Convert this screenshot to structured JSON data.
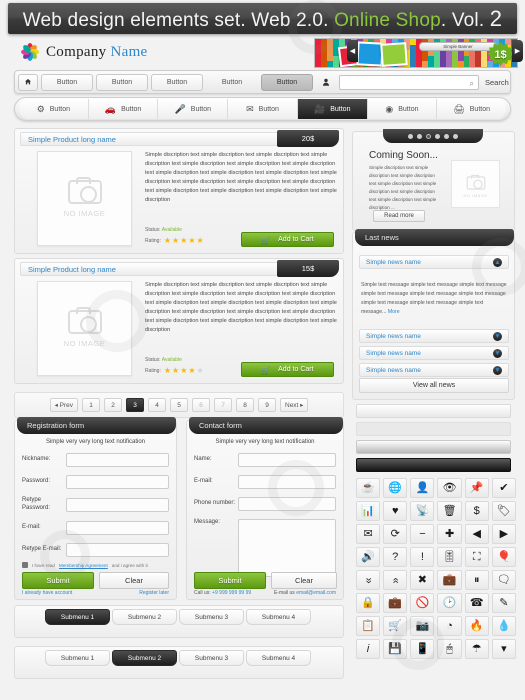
{
  "title": {
    "part1": "Web design elements set. Web 2.0. ",
    "highlight": "Online Shop",
    "part3": ". Vol. ",
    "volume": "2"
  },
  "logo": {
    "company": "Company ",
    "name": "Name"
  },
  "banner": {
    "label": "Simple Banner",
    "price_badge": "1$"
  },
  "topnav": {
    "home_icon": "home-icon",
    "buttons": [
      "Button",
      "Button",
      "Button",
      "Button",
      "Button"
    ],
    "user_icon": "user-icon",
    "search_placeholder": "",
    "search_label": "Search",
    "search_icon": "magnifier-icon"
  },
  "subnav": {
    "items": [
      {
        "label": "Button",
        "icon": "gear-icon"
      },
      {
        "label": "Button",
        "icon": "car-icon"
      },
      {
        "label": "Button",
        "icon": "microphone-icon"
      },
      {
        "label": "Button",
        "icon": "envelope-icon"
      },
      {
        "label": "Button",
        "icon": "video-camera-icon"
      },
      {
        "label": "Button",
        "icon": "disc-icon"
      },
      {
        "label": "Button",
        "icon": "printer-icon"
      }
    ],
    "active_index": 4
  },
  "products": [
    {
      "title": "Simple Product long name",
      "price": "20$",
      "image_placeholder": "NO IMAGE",
      "description": "Simple discription text simple discription text simple discription text simple discription text simple discription text simple discription text simple discription text simple discription text simple discription text simple discription text simple discription text simple discription text simple discription text simple discription text simple discription text simple discription text simple discription text simple discription",
      "status_label": "Status:",
      "status_value": "Available",
      "rating_label": "Rating:",
      "rating": 5,
      "cart_button": "Add to Cart"
    },
    {
      "title": "Simple Product long name",
      "price": "15$",
      "image_placeholder": "NO IMAGE",
      "description": "Simple discription text simple discription text simple discription text simple discription text simple discription text simple discription text simple discription text simple discription text simple discription text simple discription text simple discription text simple discription text simple discription text simple discription text simple discription text simple discription text simple discription text simple discription",
      "status_label": "Status:",
      "status_value": "Available",
      "rating_label": "Rating:",
      "rating": 4,
      "cart_button": "Add to Cart"
    }
  ],
  "coming_soon": {
    "title": "Coming Soon...",
    "text": "Simple discription text simple discription text simple discription text simple discription text simple discription text simple discription text simple discription text simple discription ...",
    "image_placeholder": "NO IMAGE",
    "read_more": "Read more",
    "prev_arrow": "◀",
    "next_arrow": "▶"
  },
  "news": {
    "header": "Last news",
    "items": [
      "Simple news name",
      "Simple news name",
      "Simple news name",
      "Simple news name"
    ],
    "body": "Simple text message simple text message  simple text message simple text message simple text message simple text message simple text message simple text message simple text message... ",
    "more": "More",
    "view_all": "View all news"
  },
  "pagination": {
    "prev": "◂ Prev",
    "pages": [
      "1",
      "2",
      "3",
      "4",
      "5",
      "6",
      "7",
      "8",
      "9"
    ],
    "active": "3",
    "next": "Next ▸"
  },
  "registration_form": {
    "header": "Registration form",
    "note": "Simple very very long text notification",
    "fields": [
      {
        "label": "Nickname:",
        "value": ""
      },
      {
        "label": "Password:",
        "value": ""
      },
      {
        "label": "Retype Password:",
        "value": ""
      },
      {
        "label": "E-mail:",
        "value": ""
      },
      {
        "label": "Retype E-mail:",
        "value": ""
      }
    ],
    "agreement_pre": "I have read ",
    "agreement_link": "Membership Agreement",
    "agreement_post": " and i agree with it",
    "submit": "Submit",
    "clear": "Clear",
    "foot_left": "I already have account",
    "foot_right": "Register later"
  },
  "contact_form": {
    "header": "Contact form",
    "note": "Simple very very long text notification",
    "fields": [
      {
        "label": "Name:",
        "value": ""
      },
      {
        "label": "E-mail:",
        "value": ""
      },
      {
        "label": "Phone number:",
        "value": ""
      }
    ],
    "message_label": "Message:",
    "message_value": "",
    "submit": "Submit",
    "clear": "Clear",
    "call_label": "Call us:",
    "call_value": "+9 999 999 99 99",
    "email_label": "E-mail us",
    "email_value": "email@email.com"
  },
  "submenu_bars": [
    {
      "tabs": [
        "Submenu 1",
        "Submenu 2",
        "Submenu 3",
        "Submenu 4"
      ],
      "active": 0
    },
    {
      "tabs": [
        "Submenu 1",
        "Submenu 2",
        "Submenu 3",
        "Submenu 4"
      ],
      "active": 1
    }
  ],
  "icon_grid": {
    "icons": [
      "coffee-icon",
      "globe-icon",
      "user-icon",
      "eye-icon",
      "pushpin-icon",
      "check-icon",
      "bar-chart-icon",
      "heart-icon",
      "rss-icon",
      "trash-icon",
      "dollar-icon",
      "tag-icon",
      "envelope-icon",
      "refresh-icon",
      "minus-icon",
      "plus-icon",
      "arrow-left-icon",
      "arrow-right-icon",
      "volume-icon",
      "question-icon",
      "exclamation-icon",
      "sliders-icon",
      "expand-icon",
      "balloon-icon",
      "chevrons-down-icon",
      "chevrons-up-icon",
      "close-icon",
      "briefcase-icon",
      "pause-icon",
      "comment-icon",
      "lock-icon",
      "suitcase-icon",
      "forbidden-icon",
      "clock-icon",
      "phone-icon",
      "pencil-icon",
      "clipboard-icon",
      "cart-icon",
      "camera-icon",
      "pie-chart-icon",
      "flame-icon",
      "droplet-icon",
      "info-icon",
      "save-icon",
      "mobile-icon",
      "mouse-icon",
      "umbrella-icon",
      "chevron-down-icon"
    ]
  },
  "colors": {
    "accent_green": "#8cc63e",
    "link_blue": "#2f86c8",
    "dark": "#1e1e1e",
    "star": "#f5b909"
  }
}
